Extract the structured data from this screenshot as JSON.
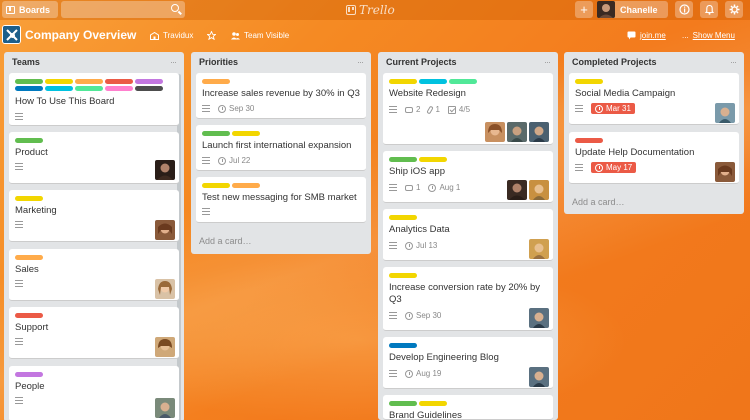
{
  "topbar": {
    "boards_label": "Boards",
    "logo_text": "Trello",
    "user_name": "Chanelle"
  },
  "board": {
    "title": "Company Overview",
    "team": "Travidux",
    "visibility": "Team Visible",
    "powerup": "join.me",
    "menu": "Show Menu",
    "ellipsis": "..."
  },
  "colors": {
    "green": "#61bd4f",
    "yellow": "#f2d600",
    "orange": "#ffab4a",
    "red": "#eb5a46",
    "purple": "#c377e0",
    "blue": "#0079bf",
    "sky": "#00c2e0",
    "lime": "#51e898",
    "pink": "#ff80ce",
    "black": "#4d4d4d"
  },
  "lists": [
    {
      "name": "Teams",
      "cards": [
        {
          "title": "How To Use This Board"
        },
        {
          "title": "Product"
        },
        {
          "title": "Marketing"
        },
        {
          "title": "Sales"
        },
        {
          "title": "Support"
        },
        {
          "title": "People"
        }
      ]
    },
    {
      "name": "Priorities",
      "cards": [
        {
          "title": "Increase sales revenue by 30% in Q3",
          "due": "Sep 30"
        },
        {
          "title": "Launch first international expansion",
          "due": "Jul 22"
        },
        {
          "title": "Test new messaging for SMB market"
        }
      ],
      "add_card": "Add a card…"
    },
    {
      "name": "Current Projects",
      "cards": [
        {
          "title": "Website Redesign",
          "comments": "2",
          "attachments": "1",
          "checklist": "4/5"
        },
        {
          "title": "Ship iOS app",
          "comments": "1",
          "due": "Aug 1"
        },
        {
          "title": "Analytics Data",
          "due": "Jul 13"
        },
        {
          "title": "Increase conversion rate by 20% by Q3",
          "due": "Sep 30"
        },
        {
          "title": "Develop Engineering Blog",
          "due": "Aug 19"
        },
        {
          "title": "Brand Guidelines"
        }
      ]
    },
    {
      "name": "Completed Projects",
      "cards": [
        {
          "title": "Social Media Campaign",
          "due": "Mar 31"
        },
        {
          "title": "Update Help Documentation",
          "due": "May 17"
        }
      ],
      "add_card": "Add a card…"
    }
  ]
}
